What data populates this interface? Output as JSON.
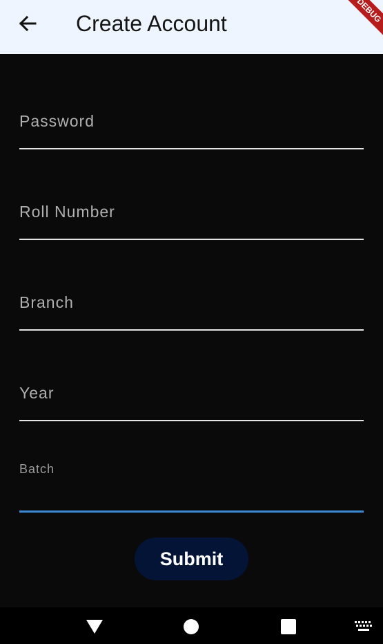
{
  "app_bar": {
    "title": "Create Account",
    "back_icon": "arrow-left-icon",
    "debug_banner": "DEBUG"
  },
  "form": {
    "fields": [
      {
        "label": "Password"
      },
      {
        "label": "Roll Number"
      },
      {
        "label": "Branch"
      },
      {
        "label": "Year"
      },
      {
        "label": "Batch"
      }
    ],
    "submit_label": "Submit"
  },
  "colors": {
    "app_bar_bg": "#eef5ff",
    "background": "#0a0a0b",
    "focused_underline": "#3a8ad8",
    "submit_bg": "#031437"
  },
  "nav": {
    "icons": [
      "back-triangle-icon",
      "home-circle-icon",
      "recents-square-icon",
      "keyboard-icon"
    ]
  }
}
